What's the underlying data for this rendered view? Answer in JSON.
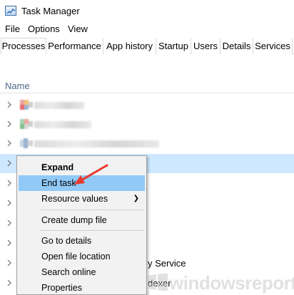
{
  "window": {
    "title": "Task Manager"
  },
  "menu": {
    "items": [
      "File",
      "Options",
      "View"
    ]
  },
  "tabs": [
    "Processes",
    "Performance",
    "App history",
    "Startup",
    "Users",
    "Details",
    "Services"
  ],
  "table": {
    "column_name": "Name"
  },
  "rows": {
    "service_text": "y Service",
    "indexer_text": "dexer"
  },
  "context_menu": {
    "items": [
      "Expand",
      "End task",
      "Resource values",
      "Create dump file",
      "Go to details",
      "Open file location",
      "Search online",
      "Properties"
    ],
    "highlighted": "End task",
    "submenu_item": "Resource values"
  },
  "watermark": {
    "text": "windowsreport"
  },
  "colors": {
    "selection": "#cde8ff",
    "menu_highlight": "#91c9f7",
    "arrow": "#e8392f"
  }
}
